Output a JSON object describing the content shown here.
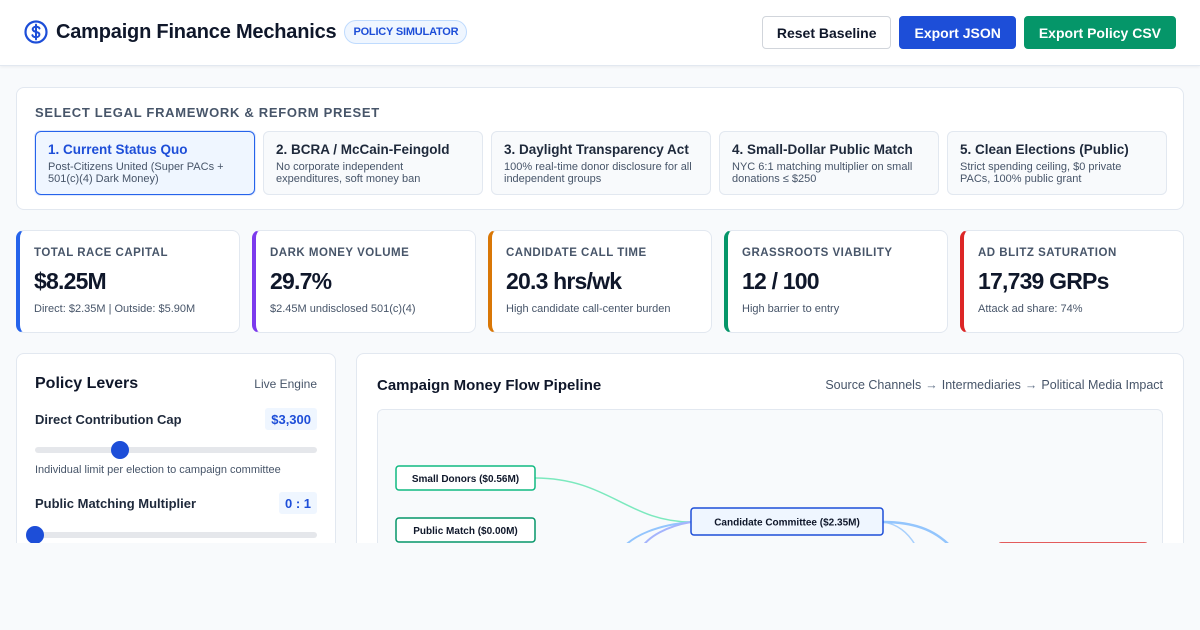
{
  "header": {
    "title": "Campaign Finance Mechanics",
    "badge": "POLICY SIMULATOR",
    "icon": "dollar-circle-icon",
    "buttons": {
      "reset": "Reset Baseline",
      "export_json": "Export JSON",
      "export_csv": "Export Policy CSV"
    }
  },
  "framework": {
    "title": "SELECT LEGAL FRAMEWORK & REFORM PRESET",
    "presets": [
      {
        "title": "1. Current Status Quo",
        "desc": "Post-Citizens United (Super PACs + 501(c)(4) Dark Money)",
        "active": true
      },
      {
        "title": "2. BCRA / McCain-Feingold",
        "desc": "No corporate independent expenditures, soft money ban",
        "active": false
      },
      {
        "title": "3. Daylight Transparency Act",
        "desc": "100% real-time donor disclosure for all independent groups",
        "active": false
      },
      {
        "title": "4. Small-Dollar Public Match",
        "desc": "NYC 6:1 matching multiplier on small donations ≤ $250",
        "active": false
      },
      {
        "title": "5. Clean Elections (Public)",
        "desc": "Strict spending ceiling, $0 private PACs, 100% public grant",
        "active": false
      }
    ]
  },
  "metrics": [
    {
      "label": "TOTAL RACE CAPITAL",
      "value": "$8.25M",
      "sub": "Direct: $2.35M | Outside: $5.90M",
      "color": "#2563eb"
    },
    {
      "label": "DARK MONEY VOLUME",
      "value": "29.7%",
      "sub": "$2.45M undisclosed 501(c)(4)",
      "color": "#7c3aed"
    },
    {
      "label": "CANDIDATE CALL TIME",
      "value": "20.3 hrs/wk",
      "sub": "High candidate call-center burden",
      "color": "#d97706"
    },
    {
      "label": "GRASSROOTS VIABILITY",
      "value": "12 / 100",
      "sub": "High barrier to entry",
      "color": "#059669"
    },
    {
      "label": "AD BLITZ SATURATION",
      "value": "17,739 GRPs",
      "sub": "Attack ad share: 74%",
      "color": "#dc2626"
    }
  ],
  "levers": {
    "title": "Policy Levers",
    "tag": "Live Engine",
    "items": [
      {
        "name": "Direct Contribution Cap",
        "value": "$3,300",
        "fraction": 0.3,
        "note": "Individual limit per election to campaign committee"
      },
      {
        "name": "Public Matching Multiplier",
        "value": "0 : 1",
        "fraction": 0.0,
        "note": ""
      }
    ]
  },
  "pipeline": {
    "title": "Campaign Money Flow Pipeline",
    "legend": [
      "Source Channels",
      "Intermediaries",
      "Political Media Impact"
    ],
    "legend_arrow": "→",
    "nodes": {
      "small_donors": {
        "label": "Small Donors ($0.56M)",
        "color": "#10b981"
      },
      "public_match": {
        "label": "Public Match ($0.00M)",
        "color": "#059669"
      },
      "candidate_committee": {
        "label": "Candidate Committee ($2.35M)",
        "color": "#1d4ed8"
      },
      "media_target": {
        "label": "",
        "color": "#dc2626"
      }
    }
  }
}
